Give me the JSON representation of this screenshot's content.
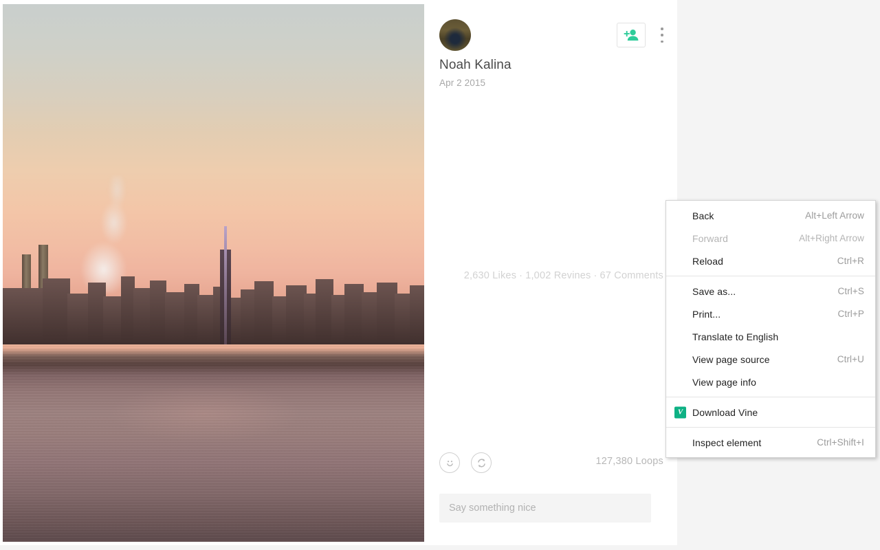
{
  "post": {
    "author_name": "Noah Kalina",
    "date": "Apr 2 2015",
    "avatar_alt": "avatar",
    "follow_icon": "add-person-icon",
    "more_icon": "kebab-menu-icon",
    "stats": {
      "likes": "2,630 Likes",
      "revines": "1,002 Revines",
      "comments": "67 Comments",
      "separator": "·"
    },
    "actions": {
      "like_icon": "smiley-face-icon",
      "revine_icon": "revine-loop-icon",
      "loops": "127,380 Loops"
    },
    "comment": {
      "placeholder": "Say something nice",
      "value": ""
    }
  },
  "context_menu": {
    "groups": [
      {
        "items": [
          {
            "label": "Back",
            "accel": "Alt+Left Arrow",
            "disabled": false,
            "icon": ""
          },
          {
            "label": "Forward",
            "accel": "Alt+Right Arrow",
            "disabled": true,
            "icon": ""
          },
          {
            "label": "Reload",
            "accel": "Ctrl+R",
            "disabled": false,
            "icon": ""
          }
        ]
      },
      {
        "items": [
          {
            "label": "Save as...",
            "accel": "Ctrl+S",
            "disabled": false,
            "icon": ""
          },
          {
            "label": "Print...",
            "accel": "Ctrl+P",
            "disabled": false,
            "icon": ""
          },
          {
            "label": "Translate to English",
            "accel": "",
            "disabled": false,
            "icon": ""
          },
          {
            "label": "View page source",
            "accel": "Ctrl+U",
            "disabled": false,
            "icon": ""
          },
          {
            "label": "View page info",
            "accel": "",
            "disabled": false,
            "icon": ""
          }
        ]
      },
      {
        "items": [
          {
            "label": "Download Vine",
            "accel": "",
            "disabled": false,
            "icon": "vine-icon",
            "icon_glyph": "V"
          }
        ]
      },
      {
        "items": [
          {
            "label": "Inspect element",
            "accel": "Ctrl+Shift+I",
            "disabled": false,
            "icon": ""
          }
        ]
      }
    ]
  },
  "colors": {
    "page_background": "#f4f4f4",
    "card_background": "#ffffff",
    "vine_green": "#0eb184",
    "accent_green": "#2ecc9a",
    "muted_text": "#b2b2b2",
    "menu_text": "#222222",
    "menu_accel": "#9b9b9b"
  }
}
